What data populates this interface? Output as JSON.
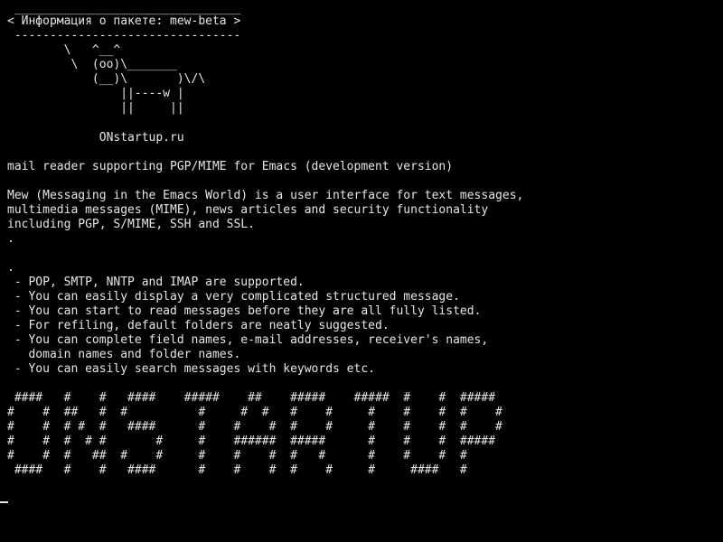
{
  "terminal": {
    "bubble_top": " ________________________________",
    "bubble_text": "< Информация о пакете: mew-beta >",
    "bubble_bottom": " --------------------------------",
    "cow": [
      "        \\   ^__^",
      "         \\  (oo)\\_______",
      "            (__)\\       )\\/\\",
      "                ||----w |",
      "                ||     ||"
    ],
    "site": "             ONstartup.ru",
    "short_description": "mail reader supporting PGP/MIME for Emacs (development version)",
    "long_description": [
      "Mew (Messaging in the Emacs World) is a user interface for text messages,",
      "multimedia messages (MIME), news articles and security functionality",
      "including PGP, S/MIME, SSH and SSL.",
      "."
    ],
    "features_dot": ".",
    "features": [
      " - POP, SMTP, NNTP and IMAP are supported.",
      " - You can easily display a very complicated structured message.",
      " - You can start to read messages before they are all fully listed.",
      " - For refiling, default folders are neatly suggested.",
      " - You can complete field names, e-mail addresses, receiver's names,",
      "   domain names and folder names.",
      " - You can easily search messages with keywords etc."
    ],
    "banner": [
      " ####   #    #   ####    #####    ##    #####    #####  #    #  #####",
      "#    #  ##   #  #          #     #  #   #    #     #    #    #  #    #",
      "#    #  # #  #   ####      #    #    #  #    #     #    #    #  #    #",
      "#    #  #  # #       #     #    ######  #####      #    #    #  #####",
      "#    #  #   ##  #    #     #    #    #  #   #      #    #    #  #",
      " ####   #    #   ####      #    #    #  #    #     #     ####   #"
    ]
  }
}
